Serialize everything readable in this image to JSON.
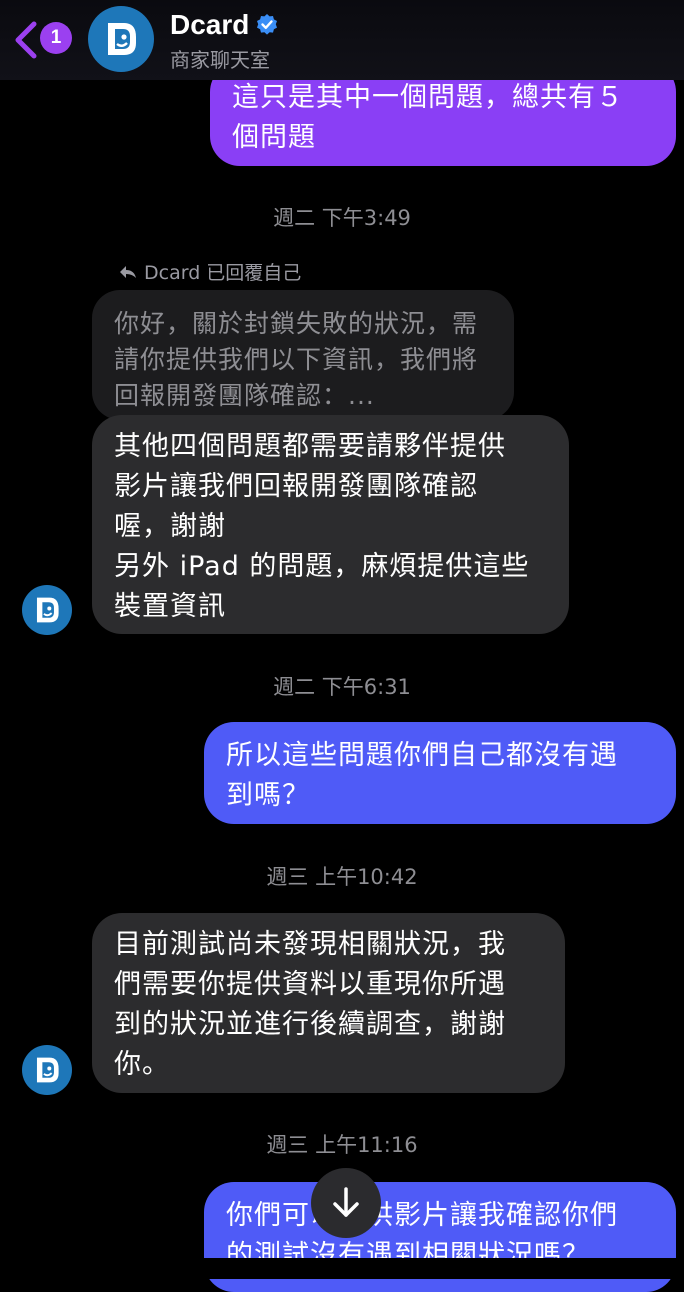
{
  "header": {
    "back_count": "1",
    "title": "Dcard",
    "subtitle": "商家聊天室",
    "verified": true
  },
  "messages": {
    "m1": "這只是其中一個問題，總共有５\n個問題",
    "ts1": "週二 下午3:49",
    "reply_label": "Dcard 已回覆自己",
    "quoted": "你好，關於封鎖失敗的狀況，需\n請你提供我們以下資訊，我們將\n回報開發團隊確認：...",
    "m2": "其他四個問題都需要請夥伴提供\n影片讓我們回報開發團隊確認\n喔，謝謝\n另外 iPad 的問題，麻煩提供這些\n裝置資訊",
    "ts2": "週二 下午6:31",
    "m3": "所以這些問題你們自己都沒有遇\n到嗎？",
    "ts3": "週三 上午10:42",
    "m4": "目前測試尚未發現相關狀況，我\n們需要你提供資料以重現你所遇\n到的狀況並進行後續調查，謝謝\n你。",
    "ts4": "週三 上午11:16",
    "m5": "你們可以提供影片讓我確認你們\n的測試沒有遇到相關狀況嗎？"
  },
  "colors": {
    "out_bubble_top": "#8a3ff5",
    "out_bubble_bottom": "#4f5bf7",
    "in_bubble": "#2c2c2e",
    "badge": "#9b40f0",
    "avatar": "#1e77b9"
  },
  "icons": [
    "chevron-left-icon",
    "verified-icon",
    "reply-icon",
    "dcard-logo-icon",
    "arrow-down-icon"
  ]
}
